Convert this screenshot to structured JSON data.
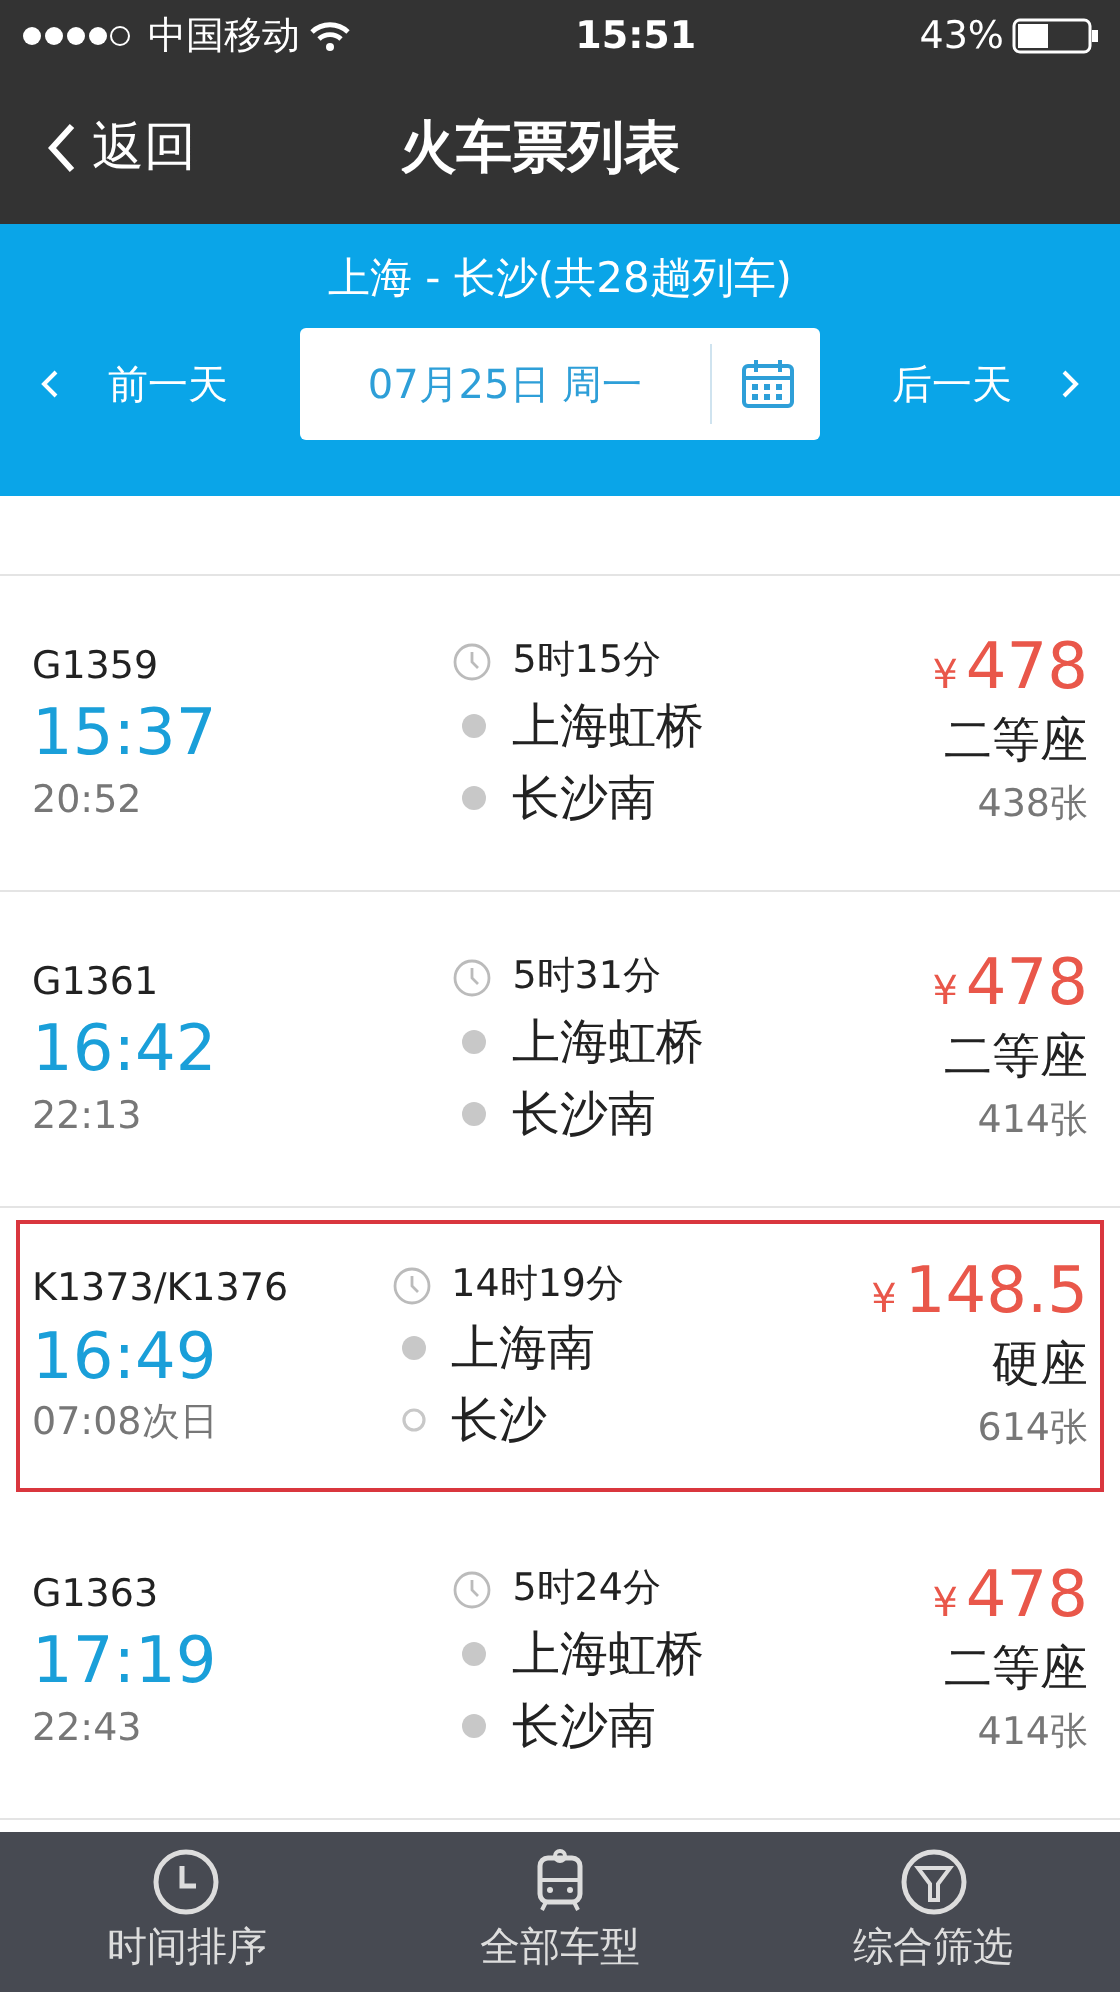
{
  "status_bar": {
    "carrier": "中国移动",
    "time": "15:51",
    "battery": "43%"
  },
  "nav": {
    "back": "返回",
    "title": "火车票列表"
  },
  "route": "上海 - 长沙(共28趟列车)",
  "date_bar": {
    "prev": "前一天",
    "date": "07月25日 周一",
    "next": "后一天"
  },
  "trains": [
    {
      "number": "G1359",
      "depart": "15:37",
      "arrive": "20:52",
      "duration": "5时15分",
      "from": {
        "name": "上海虹桥",
        "terminal": true
      },
      "to": {
        "name": "长沙南",
        "terminal": true
      },
      "currency": "¥",
      "price": "478",
      "seat": "二等座",
      "tickets": "438张",
      "selected": false
    },
    {
      "number": "G1361",
      "depart": "16:42",
      "arrive": "22:13",
      "duration": "5时31分",
      "from": {
        "name": "上海虹桥",
        "terminal": true
      },
      "to": {
        "name": "长沙南",
        "terminal": true
      },
      "currency": "¥",
      "price": "478",
      "seat": "二等座",
      "tickets": "414张",
      "selected": false
    },
    {
      "number": "K1373/K1376",
      "depart": "16:49",
      "arrive": "07:08次日",
      "duration": "14时19分",
      "from": {
        "name": "上海南",
        "terminal": true
      },
      "to": {
        "name": "长沙",
        "terminal": false
      },
      "currency": "¥",
      "price": "148.5",
      "seat": "硬座",
      "tickets": "614张",
      "selected": true
    },
    {
      "number": "G1363",
      "depart": "17:19",
      "arrive": "22:43",
      "duration": "5时24分",
      "from": {
        "name": "上海虹桥",
        "terminal": true
      },
      "to": {
        "name": "长沙南",
        "terminal": true
      },
      "currency": "¥",
      "price": "478",
      "seat": "二等座",
      "tickets": "414张",
      "selected": false
    }
  ],
  "tab_bar": [
    {
      "kind": "clock",
      "label": "时间排序"
    },
    {
      "kind": "train",
      "label": "全部车型"
    },
    {
      "kind": "filter",
      "label": "综合筛选"
    }
  ]
}
